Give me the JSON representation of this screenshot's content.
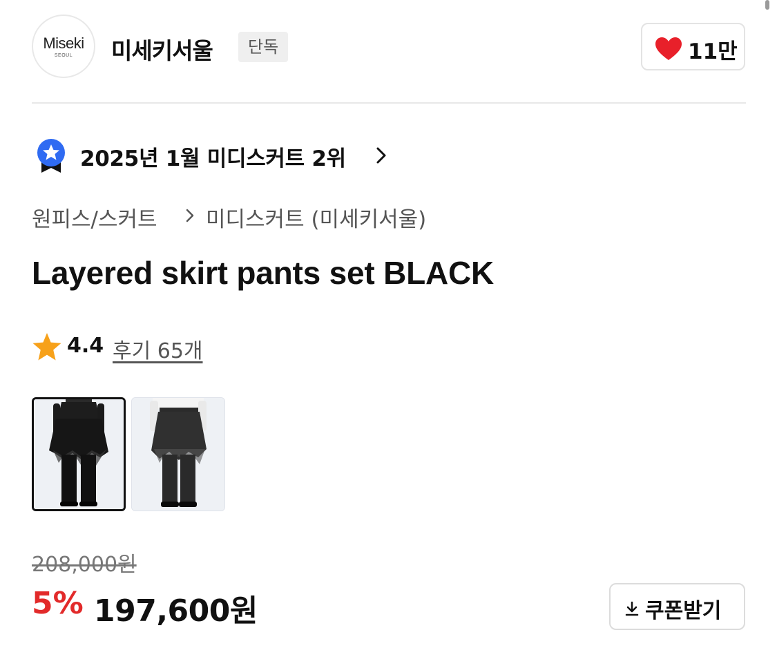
{
  "brand": {
    "logo_text": "Miseki",
    "logo_subtext": "SEOUL",
    "name": "미세키서울",
    "badge": "단독"
  },
  "like": {
    "icon": "heart-icon",
    "count": "11만",
    "color": "#e8202a"
  },
  "ranking": {
    "icon": "ranking-ribbon-icon",
    "text": "2025년 1월 미디스커트 2위",
    "color": "#2f6bf2"
  },
  "breadcrumb": {
    "items": [
      "원피스/스커트",
      "미디스커트 (미세키서울)"
    ]
  },
  "product": {
    "title": "Layered skirt pants set BLACK"
  },
  "rating": {
    "score": "4.4",
    "review_label": "후기 65개",
    "star_color": "#f7a11a"
  },
  "thumbnails": [
    {
      "label": "front-view",
      "selected": true
    },
    {
      "label": "side-view",
      "selected": false
    }
  ],
  "price": {
    "original": "208,000원",
    "discount_rate": "5%",
    "sale": "197,600원",
    "discount_color": "#e22a2a"
  },
  "coupon": {
    "icon": "download-icon",
    "label": "쿠폰받기"
  }
}
